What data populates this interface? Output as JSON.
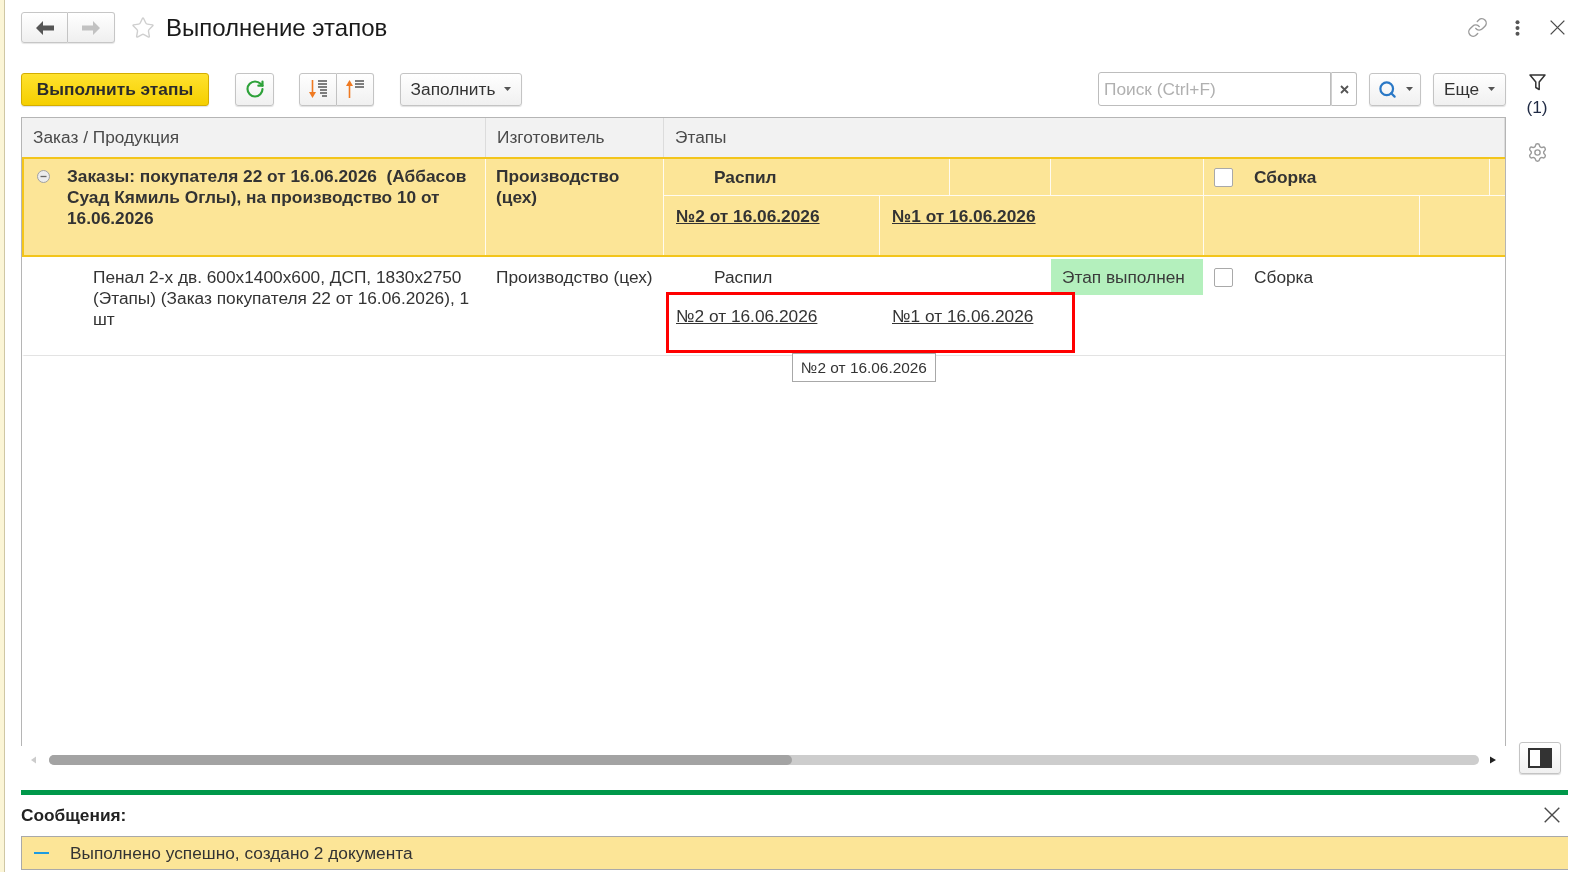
{
  "window": {
    "title": "Выполнение этапов",
    "favorite": false,
    "navigation": [
      {
        "kind": "back",
        "disabled": false
      },
      {
        "kind": "forward",
        "disabled": true
      }
    ]
  },
  "toolbar": {
    "execute_button": "Выполнить этапы",
    "fill_button": "Заполнить",
    "search": {
      "placeholder": "Поиск (Ctrl+F)"
    },
    "more_button": "Еще"
  },
  "side_panel": {
    "filter_count": "(1)"
  },
  "table": {
    "columns": [
      "Заказ / Продукция",
      "Изготовитель",
      "Этапы"
    ],
    "rows": [
      {
        "kind": "group",
        "selected": true,
        "expanded": true,
        "product": "Заказы: покупателя 22 от 16.06.2026  (Аббасов Суад Кямиль Оглы), на производство 10 от 16.06.2026",
        "manufacturer": "Производство (цех)",
        "stages": [
          {
            "name": "Распил",
            "documents": [
              {
                "label": "№2 от 16.06.2026"
              },
              {
                "label": "№1 от 16.06.2026"
              }
            ]
          },
          {
            "name": "Сборка",
            "checked": false
          }
        ]
      },
      {
        "kind": "item",
        "selected": false,
        "product": "Пенал 2-х дв. 600x1400x600, ДСП, 1830x2750 (Этапы) (Заказ покупателя 22 от 16.06.2026), 1 шт",
        "manufacturer": "Производство (цех)",
        "stages": [
          {
            "name": "Распил",
            "status": "Этап выполнен",
            "highlighted": true,
            "documents": [
              {
                "label": "№2 от 16.06.2026",
                "tooltip": "№2 от 16.06.2026"
              },
              {
                "label": "№1 от 16.06.2026"
              }
            ]
          },
          {
            "name": "Сборка",
            "checked": false
          }
        ]
      }
    ]
  },
  "messages": {
    "title": "Сообщения:",
    "items": [
      {
        "text": "Выполнено успешно, создано 2 документа"
      }
    ]
  }
}
